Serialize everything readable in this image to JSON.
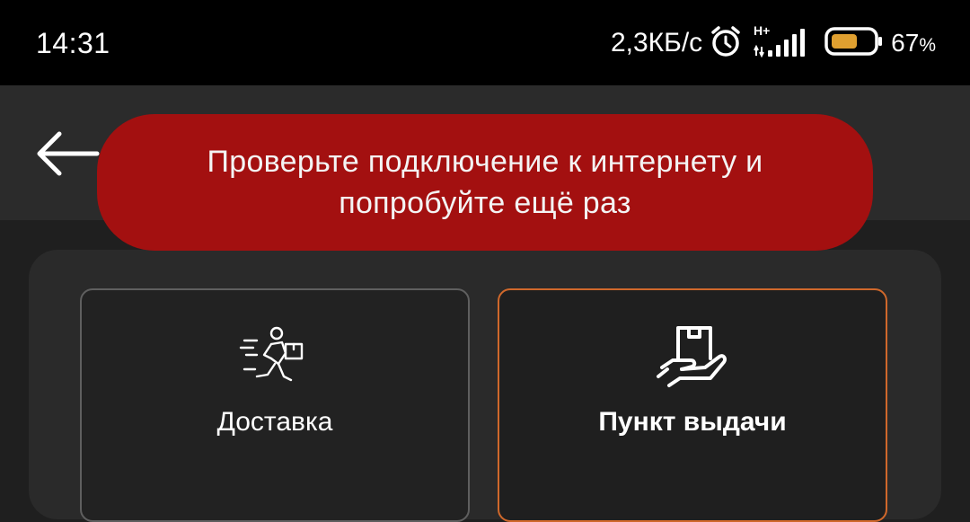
{
  "status_bar": {
    "time": "14:31",
    "net_speed": "2,3КБ/с",
    "network_type": "H+",
    "battery_percent": "67",
    "battery_sign": "%",
    "battery_level": 0.67,
    "battery_color": "#e0a030",
    "icons": [
      "alarm-icon",
      "signal-icon",
      "battery-icon"
    ]
  },
  "app_bar": {
    "back_icon": "arrow-left-icon"
  },
  "toast": {
    "line1": "Проверьте подключение к интернету и",
    "line2": "попробуйте ещё раз",
    "color": "#a31010"
  },
  "options": {
    "delivery": {
      "label": "Доставка",
      "icon": "courier-running-icon",
      "selected": false
    },
    "pickup": {
      "label": "Пункт выдачи",
      "icon": "pickup-point-hand-icon",
      "selected": true,
      "accent_color": "#d0682b"
    }
  }
}
